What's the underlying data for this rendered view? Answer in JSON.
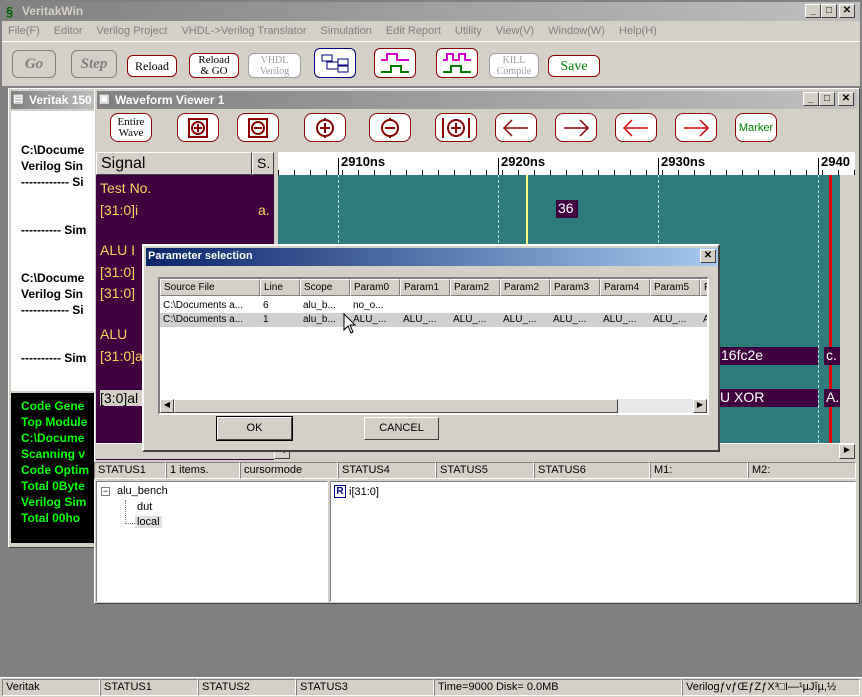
{
  "app": {
    "title": "VeritakWin",
    "menu": [
      "File(F)",
      "Editor",
      "Verilog Project",
      "VHDL->Verilog Translator",
      "Simulation",
      "Edit Report",
      "Utility",
      "View(V)",
      "Window(W)",
      "Help(H)"
    ],
    "toolbar": {
      "go": "Go",
      "step": "Step",
      "reload": "Reload",
      "reload_go_1": "Reload",
      "reload_go_2": "& GO",
      "vhdl_1": "VHDL",
      "vhdl_2": "Verilog",
      "kill_1": "KILL",
      "kill_2": "Compile",
      "save": "Save"
    }
  },
  "veritak_window": {
    "title": "Veritak 150",
    "log_lines": [
      "C:\\Docume",
      "Verilog Sin",
      "------------ Si",
      "---------- Sim",
      "C:\\Docume",
      "Verilog Sin",
      "------------ Si",
      "---------- Sim"
    ],
    "green_lines": [
      "Code Gene",
      "Top Module",
      "C:\\Docume",
      "Scanning v",
      "Code Optim",
      "Total 0Byte",
      "Verilog Sim",
      "Total  00ho"
    ]
  },
  "waveform": {
    "title": "Waveform Viewer 1",
    "toolbar": {
      "entire_1": "Entire",
      "entire_2": "Wave",
      "marker": "Marker"
    },
    "signal_header": "Signal",
    "s_header": "S.",
    "time_labels": [
      "2910ns",
      "2920ns",
      "2930ns",
      "2940"
    ],
    "signals": [
      "Test No.",
      "[31:0]i",
      "ALU I",
      "[31:0]",
      "[31:0]",
      "ALU",
      "[31:0]a",
      "[3:0]al"
    ],
    "signal_suffix": "a.",
    "wave_values": {
      "i_value": "36",
      "hex_value": "16fc2e",
      "c_value": "c.",
      "xor_value": "U  XOR",
      "a_value": "A."
    },
    "status": [
      "STATUS1",
      "1 items.",
      "cursormode",
      "STATUS4",
      "STATUS5",
      "STATUS6",
      "M1:",
      "M2:"
    ],
    "tree": {
      "root": "alu_bench",
      "child1": "dut",
      "child2": "local"
    },
    "object_badge": "R",
    "object_label": "i[31:0]"
  },
  "dialog": {
    "title": "Parameter selection",
    "columns": [
      "Source File",
      "Line",
      "Scope",
      "Param0",
      "Param1",
      "Param2",
      "Param2",
      "Param3",
      "Param4",
      "Param5",
      "P"
    ],
    "rows": [
      [
        "C:\\Documents a...",
        "6",
        "alu_b...",
        "no_o...",
        "",
        "",
        "",
        "",
        "",
        "",
        ""
      ],
      [
        "C:\\Documents a...",
        "1",
        "alu_b...",
        "ALU_...",
        "ALU_...",
        "ALU_...",
        "ALU_...",
        "ALU_...",
        "ALU_...",
        "ALU_...",
        "A"
      ]
    ],
    "ok": "OK",
    "cancel": "CANCEL"
  },
  "statusbar": [
    "Veritak",
    "STATUS1",
    "STATUS2",
    "STATUS3",
    "Time=9000 Disk= 0.0MB",
    "VerilogƒvƒŒƒZƒX³□I—¹µJîµ,½"
  ]
}
